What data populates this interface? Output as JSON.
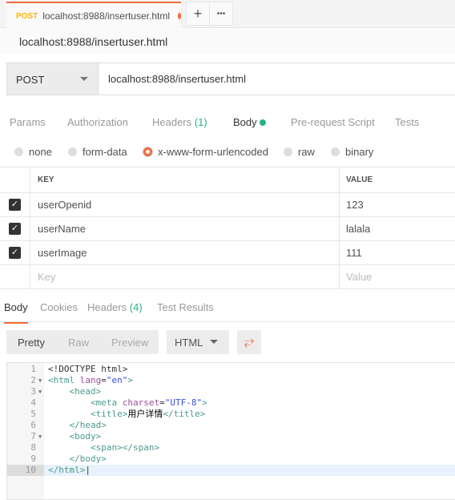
{
  "tab": {
    "method": "POST",
    "title": "localhost:8988/insertuser.html",
    "new_tab": "+",
    "more": "•••"
  },
  "request": {
    "title": "localhost:8988/insertuser.html",
    "method": "POST",
    "url": "localhost:8988/insertuser.html"
  },
  "req_tabs": [
    {
      "label": "Params"
    },
    {
      "label": "Authorization"
    },
    {
      "label": "Headers",
      "count": "(1)"
    },
    {
      "label": "Body",
      "active": true
    },
    {
      "label": "Pre-request Script"
    },
    {
      "label": "Tests"
    }
  ],
  "body_types": [
    "none",
    "form-data",
    "x-www-form-urlencoded",
    "raw",
    "binary"
  ],
  "body_type_selected": "x-www-form-urlencoded",
  "params": {
    "headers": {
      "key": "KEY",
      "value": "VALUE"
    },
    "rows": [
      {
        "key": "userOpenid",
        "value": "123",
        "checked": true
      },
      {
        "key": "userName",
        "value": "lalala",
        "checked": true
      },
      {
        "key": "userImage",
        "value": "111",
        "checked": true
      }
    ],
    "placeholder": {
      "key": "Key",
      "value": "Value"
    }
  },
  "resp_tabs": [
    {
      "label": "Body",
      "active": true
    },
    {
      "label": "Cookies"
    },
    {
      "label": "Headers",
      "count": "(4)"
    },
    {
      "label": "Test Results"
    }
  ],
  "view_modes": [
    "Pretty",
    "Raw",
    "Preview"
  ],
  "format": "HTML",
  "code_lines": [
    "1",
    "2",
    "3",
    "4",
    "5",
    "6",
    "7",
    "8",
    "9",
    "10"
  ],
  "colors": {
    "accent": "#f26b3a",
    "tag": "#4a9a8f",
    "attr": "#9b4d9b",
    "string": "#3a4fd8"
  }
}
